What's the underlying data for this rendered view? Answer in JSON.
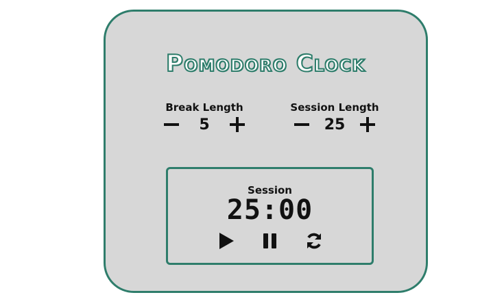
{
  "app": {
    "title": "Pomodoro Clock"
  },
  "break": {
    "label": "Break Length",
    "value": "5",
    "decrement_icon": "minus-icon",
    "increment_icon": "plus-icon"
  },
  "session": {
    "label": "Session Length",
    "value": "25",
    "decrement_icon": "minus-icon",
    "increment_icon": "plus-icon"
  },
  "timer": {
    "label": "Session",
    "time": "25:00",
    "controls": [
      "play-icon",
      "pause-icon",
      "refresh-icon"
    ]
  },
  "colors": {
    "accent": "#2e7d6b",
    "card_bg": "#d7d7d7",
    "text": "#111111"
  }
}
